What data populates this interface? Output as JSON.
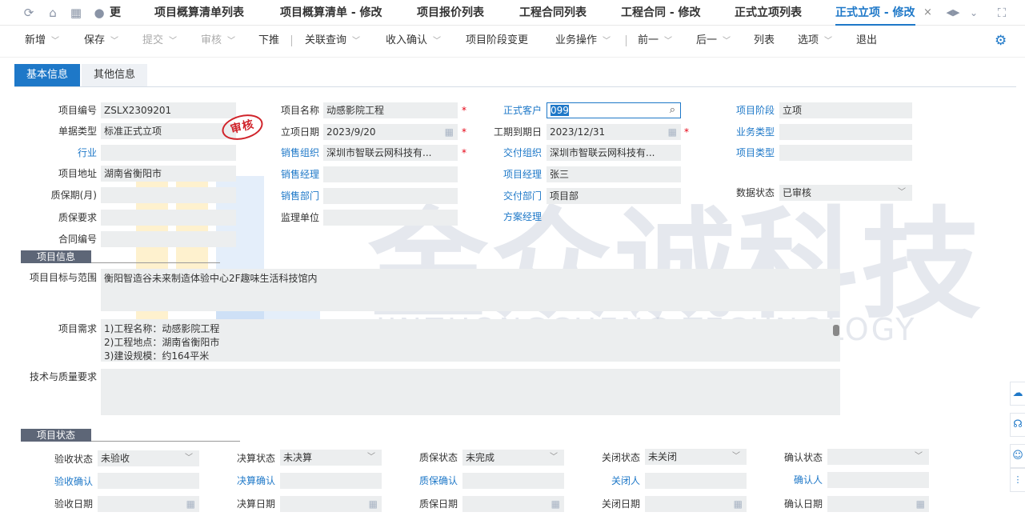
{
  "tabs": {
    "items": [
      {
        "label": "更"
      },
      {
        "label": "项目概算清单列表"
      },
      {
        "label": "项目概算清单 - 修改"
      },
      {
        "label": "项目报价列表"
      },
      {
        "label": "工程合同列表"
      },
      {
        "label": "工程合同 - 修改"
      },
      {
        "label": "正式立项列表"
      },
      {
        "label": "正式立项 - 修改"
      }
    ],
    "close": "×"
  },
  "toolbar": {
    "add": "新增",
    "save": "保存",
    "submit": "提交",
    "audit": "审核",
    "push": "下推",
    "related": "关联查询",
    "income": "收入确认",
    "stage_change": "项目阶段变更",
    "biz_ops": "业务操作",
    "prev": "前一",
    "next": "后一",
    "list": "列表",
    "options": "选项",
    "exit": "退出"
  },
  "form_tabs": {
    "basic": "基本信息",
    "other": "其他信息"
  },
  "stamp": "审核",
  "basic": {
    "project_no_label": "项目编号",
    "project_no": "ZSLX2309201",
    "doc_type_label": "单据类型",
    "doc_type": "标准正式立项",
    "industry_label": "行业",
    "industry": "",
    "address_label": "项目地址",
    "address": "湖南省衡阳市",
    "warranty_label": "质保期(月)",
    "warranty": "",
    "warranty_req_label": "质保要求",
    "warranty_req": "",
    "contract_no_label": "合同编号",
    "contract_no": "",
    "project_name_label": "项目名称",
    "project_name": "动感影院工程",
    "setup_date_label": "立项日期",
    "setup_date": "2023/9/20",
    "sales_org_label": "销售组织",
    "sales_org": "深圳市智联云网科技有...",
    "sales_mgr_label": "销售经理",
    "sales_mgr": "",
    "sales_dept_label": "销售部门",
    "sales_dept": "",
    "supervisor_label": "监理单位",
    "supervisor": "",
    "customer_label": "正式客户",
    "customer": "099",
    "due_date_label": "工期到期日",
    "due_date": "2023/12/31",
    "deliver_org_label": "交付组织",
    "deliver_org": "深圳市智联云网科技有...",
    "pm_label": "项目经理",
    "pm": "张三",
    "deliver_dept_label": "交付部门",
    "deliver_dept": "项目部",
    "solution_mgr_label": "方案经理",
    "solution_mgr": "",
    "stage_label": "项目阶段",
    "stage": "立项",
    "biz_type_label": "业务类型",
    "biz_type": "",
    "proj_type_label": "项目类型",
    "proj_type": "",
    "data_status_label": "数据状态",
    "data_status": "已审核"
  },
  "info": {
    "section": "项目信息",
    "goal_label": "项目目标与范围",
    "goal": "衡阳智造谷未来制造体验中心2F趣味生活科技馆内",
    "req_label": "项目需求",
    "req_line1": "1)工程名称：动感影院工程",
    "req_line2": "2)工程地点：湖南省衡阳市",
    "req_line3": "3)建设规模：约164平米",
    "quality_label": "技术与质量要求",
    "quality": ""
  },
  "status": {
    "section": "项目状态",
    "accept_status_label": "验收状态",
    "accept_status": "未验收",
    "accept_confirm_label": "验收确认",
    "accept_date_label": "验收日期",
    "settle_status_label": "决算状态",
    "settle_status": "未决算",
    "settle_confirm_label": "决算确认",
    "settle_date_label": "决算日期",
    "wq_status_label": "质保状态",
    "wq_status": "未完成",
    "wq_confirm_label": "质保确认",
    "wq_date_label": "质保日期",
    "close_status_label": "关闭状态",
    "close_status": "未关闭",
    "closer_label": "关闭人",
    "close_date_label": "关闭日期",
    "confirm_status_label": "确认状态",
    "confirm_status": "",
    "confirmer_label": "确认人",
    "confirm_date_label": "确认日期"
  },
  "watermark": {
    "cn": "金众诚科技",
    "en": "JINZHONGCHENG TECHNOLOGY"
  },
  "colors": {
    "accent": "#1e78c8",
    "required": "#e60012",
    "field_bg": "#eceeef",
    "section": "#5d6677"
  }
}
